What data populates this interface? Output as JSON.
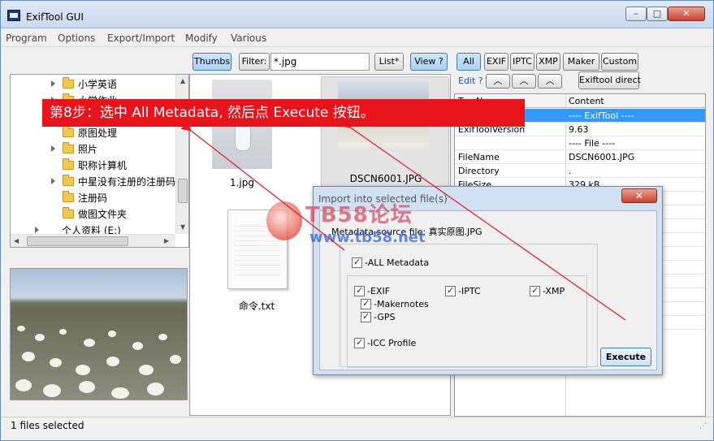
{
  "window": {
    "title": "ExifTool GUI",
    "min_glyph": "–",
    "max_glyph": "□",
    "close_glyph": "✕"
  },
  "menu": [
    "Program",
    "Options",
    "Export/Import",
    "Modify",
    "Various"
  ],
  "toolbar": {
    "thumbs": "Thumbs",
    "filter_label": "Filter:",
    "filter_value": "*.jpg",
    "list": "List*",
    "view": "View ?"
  },
  "tree": {
    "items": [
      {
        "label": "小学英语"
      },
      {
        "label": "小学作业"
      },
      {
        "label": "原图处理"
      },
      {
        "label": "照片"
      },
      {
        "label": "职称计算机"
      },
      {
        "label": "中星没有注册的注册码"
      },
      {
        "label": "注册码"
      },
      {
        "label": "做图文件夹"
      },
      {
        "label": "个人资料 (E:)"
      }
    ]
  },
  "files": [
    {
      "name": "1.jpg"
    },
    {
      "name": "DSCN6001.JPG"
    },
    {
      "name": "命令.txt"
    }
  ],
  "meta_buttons": {
    "all": "All",
    "exif": "EXIF",
    "iptc": "IPTC",
    "xmp": "XMP",
    "maker": "Maker",
    "custom": "Custom",
    "edit": "Edit ?",
    "direct": "Exiftool direct"
  },
  "meta_table": {
    "col_tag": "Tag Name",
    "col_content": "Content",
    "rows": [
      {
        "tag": "",
        "content": "---- ExifTool ----"
      },
      {
        "tag": "ExifToolVersion",
        "content": "9.63"
      },
      {
        "tag": "",
        "content": "---- File ----"
      },
      {
        "tag": "FileName",
        "content": "DSCN6001.JPG"
      },
      {
        "tag": "Directory",
        "content": "."
      },
      {
        "tag": "FileSize",
        "content": "329 kB"
      },
      {
        "tag": "",
        "content": "8:00"
      },
      {
        "tag": "",
        "content": "8:00"
      },
      {
        "tag": "",
        "content": "8:00"
      },
      {
        "tag": "",
        "content": ""
      },
      {
        "tag": "",
        "content": ""
      },
      {
        "tag": "",
        "content": ""
      },
      {
        "tag": "",
        "content": ""
      },
      {
        "tag": "",
        "content": "oding"
      },
      {
        "tag": "",
        "content": ""
      },
      {
        "tag": "",
        "content": ""
      }
    ]
  },
  "status": "1 files selected",
  "dialog": {
    "title": "Import into selected file(s)",
    "close": "✕",
    "source": "Metadata source file: 真实原图.JPG",
    "all_metadata": "-ALL Metadata",
    "exif": "-EXIF",
    "iptc": "-IPTC",
    "xmp": "-XMP",
    "makernotes": "-Makernotes",
    "gps": "-GPS",
    "icc": "-ICC Profile",
    "execute": "Execute"
  },
  "annotation": "第8步：选中  All Metadata, 然后点  Execute  按钮。",
  "watermark": {
    "title": "TB58论坛",
    "url": "www.tb58.net"
  },
  "colors": {
    "annotation_bg": "#e8141b",
    "selection": "#3399ff"
  }
}
